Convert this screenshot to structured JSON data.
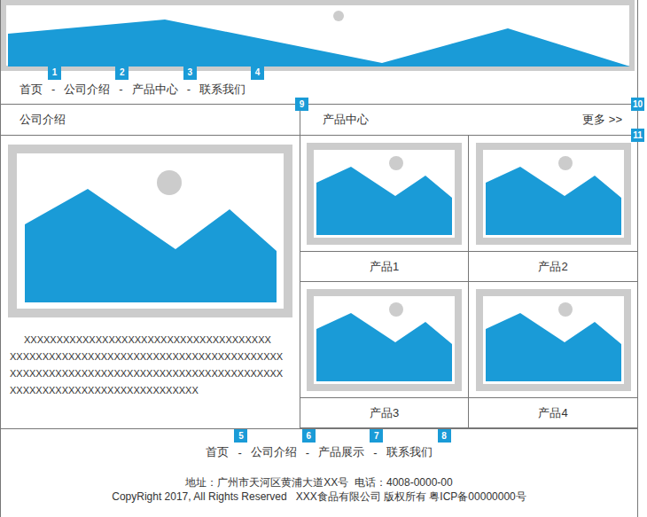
{
  "nav": {
    "separator": "-",
    "items": [
      {
        "label": "首页",
        "badge": "1"
      },
      {
        "label": "公司介绍",
        "badge": "2"
      },
      {
        "label": "产品中心",
        "badge": "3"
      },
      {
        "label": "联系我们",
        "badge": "4"
      }
    ]
  },
  "about": {
    "title": "公司介绍",
    "lines": [
      "XXXXXXXXXXXXXXXXXXXXXXXXXXXXXXXXXXXXXX",
      "XXXXXXXXXXXXXXXXXXXXXXXXXXXXXXXXXXXXXXXXXX",
      "XXXXXXXXXXXXXXXXXXXXXXXXXXXXXXXXXXXXXXXXXX",
      "XXXXXXXXXXXXXXXXXXXXXXXXXXXXX"
    ]
  },
  "products": {
    "title": "产品中心",
    "more": "更多 >>",
    "badges": [
      "9",
      "10",
      "11"
    ],
    "items": [
      {
        "name": "产品1"
      },
      {
        "name": "产品2"
      },
      {
        "name": "产品3"
      },
      {
        "name": "产品4"
      }
    ]
  },
  "footer": {
    "separator": "-",
    "links": [
      {
        "label": "首页",
        "badge": "5"
      },
      {
        "label": "公司介绍",
        "badge": "6"
      },
      {
        "label": "产品展示",
        "badge": "7"
      },
      {
        "label": "联系我们",
        "badge": "8"
      }
    ],
    "address": "地址：广州市天河区黄浦大道XX号  电话：4008-0000-00",
    "copyright": "CopyRight 2017, All Rights Reserved   XXX食品有限公司 版权所有 粤ICP备00000000号"
  }
}
